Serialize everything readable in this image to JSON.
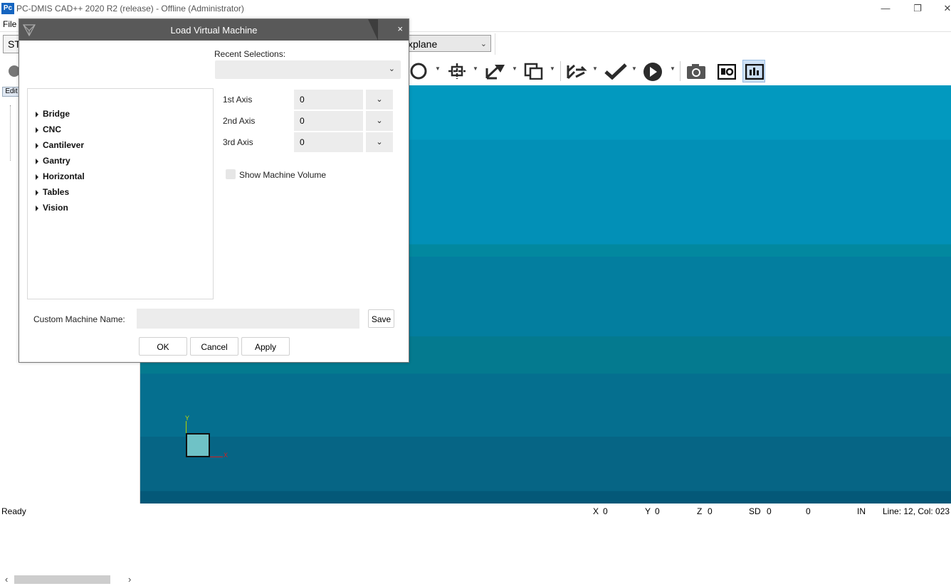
{
  "window": {
    "title": "PC-DMIS CAD++ 2020 R2 (release) - Offline (Administrator)",
    "logo_text": "Pc",
    "minimize": "—",
    "restore": "❐",
    "close": "✕"
  },
  "menu": {
    "file": "File"
  },
  "toolbar": {
    "left_combo": "ST",
    "plane_combo": "xplane",
    "icons": [
      "circle-icon",
      "crosshair-icon",
      "move-icon",
      "copy-icon",
      "path-icon",
      "check-icon",
      "play-icon",
      "camera-icon",
      "cad-view-icon",
      "cad-graph-icon"
    ]
  },
  "left_panel": {
    "edit_tab": "Edit"
  },
  "dialog": {
    "title": "Load Virtual Machine",
    "close": "×",
    "recent_label": "Recent Selections:",
    "recent_value": "",
    "tree": [
      "Bridge",
      "CNC",
      "Cantilever",
      "Gantry",
      "Horizontal",
      "Tables",
      "Vision"
    ],
    "axes": [
      {
        "label": "1st Axis",
        "value": "0"
      },
      {
        "label": "2nd Axis",
        "value": "0"
      },
      {
        "label": "3rd Axis",
        "value": "0"
      }
    ],
    "show_volume_label": "Show Machine Volume",
    "show_volume_checked": false,
    "custom_name_label": "Custom Machine Name:",
    "custom_name_value": "",
    "save": "Save",
    "ok": "OK",
    "cancel": "Cancel",
    "apply": "Apply"
  },
  "cad": {
    "axis_y": "Y",
    "axis_x": "X",
    "colors": {
      "top": "#0299bf",
      "bottom": "#045878"
    }
  },
  "status": {
    "ready": "Ready",
    "x_label": "X",
    "x_value": "0",
    "y_label": "Y",
    "y_value": "0",
    "z_label": "Z",
    "z_value": "0",
    "sd_label": "SD",
    "sd_value": "0",
    "extra_value": "0",
    "units": "IN",
    "line_col": "Line: 12, Col: 023"
  }
}
